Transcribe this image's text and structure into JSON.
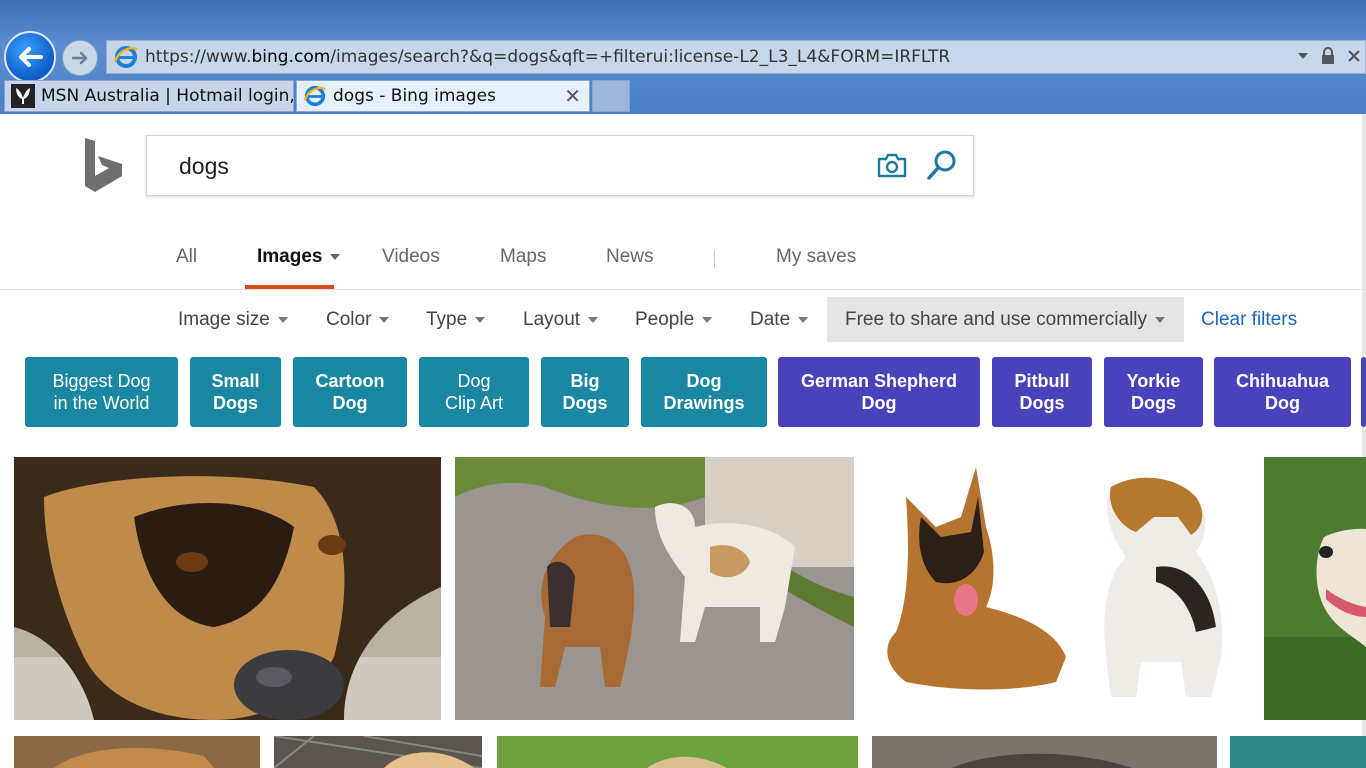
{
  "browser": {
    "address": {
      "prefix": "https://www.",
      "host": "bing.com",
      "path": "/images/search?&q=dogs&qft=+filterui:license-L2_L3_L4&FORM=IRFLTR"
    },
    "tabs": [
      {
        "label": "MSN Australia | Hotmail login, ..."
      },
      {
        "label": "dogs - Bing images"
      }
    ],
    "close_glyph": "✕"
  },
  "search": {
    "query": "dogs"
  },
  "nav": {
    "items": [
      "All",
      "Images",
      "Videos",
      "Maps",
      "News",
      "My saves"
    ]
  },
  "filters": {
    "items": [
      "Image size",
      "Color",
      "Type",
      "Layout",
      "People",
      "Date"
    ],
    "license": "Free to share and use commercially",
    "clear": "Clear filters"
  },
  "chips": [
    {
      "label": "Biggest Dog\nin the World",
      "color": "#1a87a2"
    },
    {
      "label": "Small\nDogs",
      "color": "#1a87a2"
    },
    {
      "label": "Cartoon\nDog",
      "color": "#1a87a2"
    },
    {
      "label": "Dog\nClip Art",
      "color": "#1a87a2"
    },
    {
      "label": "Big\nDogs",
      "color": "#1a87a2"
    },
    {
      "label": "Dog\nDrawings",
      "color": "#1a87a2"
    },
    {
      "label": "German Shepherd\nDog",
      "color": "#4942bb"
    },
    {
      "label": "Pitbull\nDogs",
      "color": "#4942bb"
    },
    {
      "label": "Yorkie\nDogs",
      "color": "#4942bb"
    },
    {
      "label": "Chihuahua\nDog",
      "color": "#4942bb"
    }
  ],
  "colors": {
    "accent_underline": "#d84a1b",
    "link_blue": "#1a67c3",
    "bing_teal": "#1a7aa0"
  }
}
